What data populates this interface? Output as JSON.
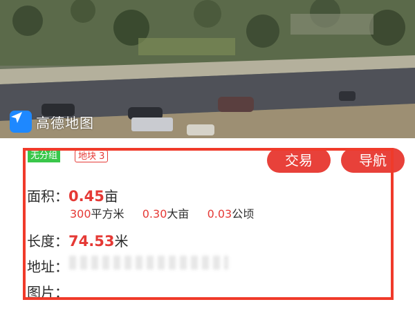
{
  "map": {
    "provider_name": "高德地图",
    "logo_icon": "navigation-arrow-icon"
  },
  "parcel": {
    "tag_group": "无分组",
    "tag_block": "地块 3",
    "buttons": {
      "trade": "交易",
      "navigate": "导航"
    },
    "area": {
      "label": "面积：",
      "value": "0.45",
      "unit": "亩",
      "sqm": "300",
      "sqm_unit": "平方米",
      "da_mu": "0.30",
      "da_mu_unit": "大亩",
      "hectare": "0.03",
      "hectare_unit": "公顷"
    },
    "length": {
      "label": "长度：",
      "value": "74.53",
      "unit": "米"
    },
    "address": {
      "label": "地址："
    },
    "pictures": {
      "label": "图片："
    }
  },
  "colors": {
    "accent": "#e8413a",
    "highlight_border": "#f03a2a",
    "group_tag": "#39c74a",
    "map_logo": "#1e88ff"
  }
}
